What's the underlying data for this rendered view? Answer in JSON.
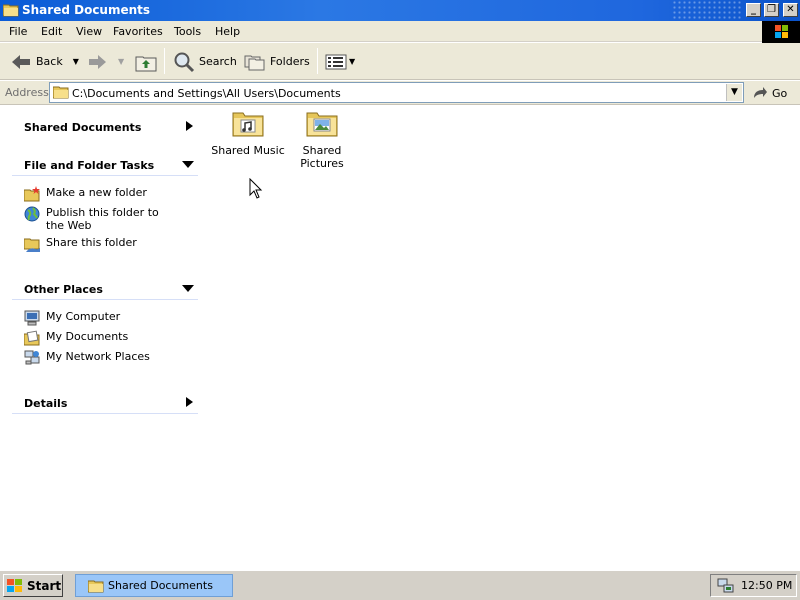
{
  "window": {
    "title": "Shared Documents"
  },
  "menu": [
    "File",
    "Edit",
    "View",
    "Favorites",
    "Tools",
    "Help"
  ],
  "toolbar": {
    "back_label": "Back",
    "search_label": "Search",
    "folders_label": "Folders"
  },
  "address": {
    "label": "Address",
    "value": "C:\\Documents and Settings\\All Users\\Documents",
    "go_label": "Go"
  },
  "left_pane": {
    "shared_documents": "Shared Documents",
    "file_folder_tasks": {
      "title": "File and Folder Tasks",
      "items": [
        "Make a new folder",
        "Publish this folder to the Web",
        "Share this folder"
      ]
    },
    "other_places": {
      "title": "Other Places",
      "items": [
        "My Computer",
        "My Documents",
        "My Network Places"
      ]
    },
    "details": "Details"
  },
  "content": {
    "items": [
      "Shared Music",
      "Shared Pictures"
    ]
  },
  "taskbar": {
    "start_label": "Start",
    "task_label": "Shared Documents",
    "clock": "12:50 PM"
  }
}
